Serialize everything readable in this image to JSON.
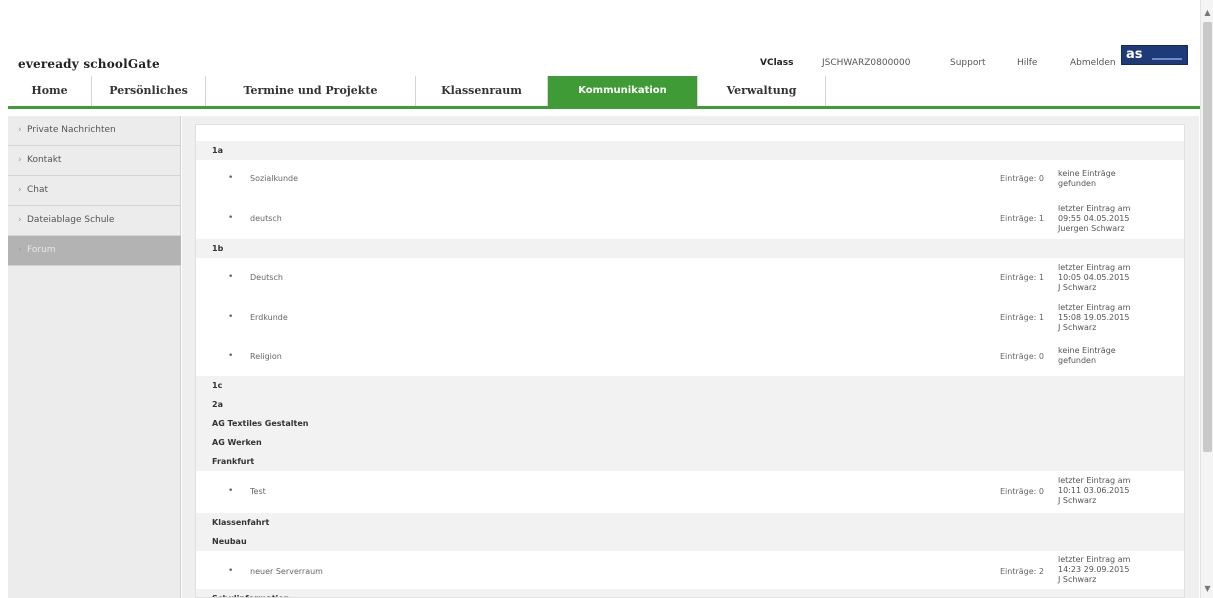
{
  "header": {
    "logo": "eveready schoolGate",
    "vclass": "VClass",
    "user": "JSCHWARZ0800000",
    "support": "Support",
    "hilfe": "Hilfe",
    "abmelden": "Abmelden",
    "brand": "as"
  },
  "nav": {
    "tabs": [
      {
        "label": "Home"
      },
      {
        "label": "Persönliches"
      },
      {
        "label": "Termine und Projekte"
      },
      {
        "label": "Klassenraum"
      },
      {
        "label": "Kommunikation",
        "active": true
      },
      {
        "label": "Verwaltung"
      }
    ]
  },
  "sidebar": {
    "items": [
      {
        "label": "Private Nachrichten"
      },
      {
        "label": "Kontakt"
      },
      {
        "label": "Chat"
      },
      {
        "label": "Dateiablage Schule"
      },
      {
        "label": "Forum",
        "active": true
      }
    ]
  },
  "forum": {
    "groups": [
      {
        "title": "1a",
        "topics": [
          {
            "name": "Sozialkunde",
            "count": "Einträge: 0",
            "last": [
              "keine Einträge",
              "gefunden"
            ]
          },
          {
            "name": "deutsch",
            "count": "Einträge: 1",
            "last": [
              "letzter Eintrag am",
              "09:55 04.05.2015",
              "Juergen Schwarz"
            ]
          }
        ]
      },
      {
        "title": "1b",
        "topics": [
          {
            "name": "Deutsch",
            "count": "Einträge: 1",
            "last": [
              "letzter Eintrag am",
              "10:05 04.05.2015",
              "J Schwarz"
            ]
          },
          {
            "name": "Erdkunde",
            "count": "Einträge: 1",
            "last": [
              "letzter Eintrag am",
              "15:08 19.05.2015",
              "J Schwarz"
            ]
          },
          {
            "name": "Religion",
            "count": "Einträge: 0",
            "last": [
              "keine Einträge",
              "gefunden"
            ]
          }
        ]
      },
      {
        "title": "1c",
        "topics": []
      },
      {
        "title": "2a",
        "topics": []
      },
      {
        "title": "AG Textiles Gestalten",
        "topics": []
      },
      {
        "title": "AG Werken",
        "topics": []
      },
      {
        "title": "Frankfurt",
        "topics": [
          {
            "name": "Test",
            "count": "Einträge: 0",
            "last": [
              "letzter Eintrag am",
              "10:11 03.06.2015",
              "J Schwarz"
            ]
          }
        ]
      },
      {
        "title": "Klassenfahrt",
        "topics": []
      },
      {
        "title": "Neubau",
        "topics": [
          {
            "name": "neuer Serverraum",
            "count": "Einträge: 2",
            "last": [
              "letzter Eintrag am",
              "14:23 29.09.2015",
              "J Schwarz"
            ]
          }
        ]
      },
      {
        "title": "Schulinformation",
        "topics": []
      }
    ]
  },
  "colors": {
    "accent_green": "#3f9b36",
    "brand_blue": "#1f3a78",
    "sidebar_active": "#b3b3b3"
  }
}
